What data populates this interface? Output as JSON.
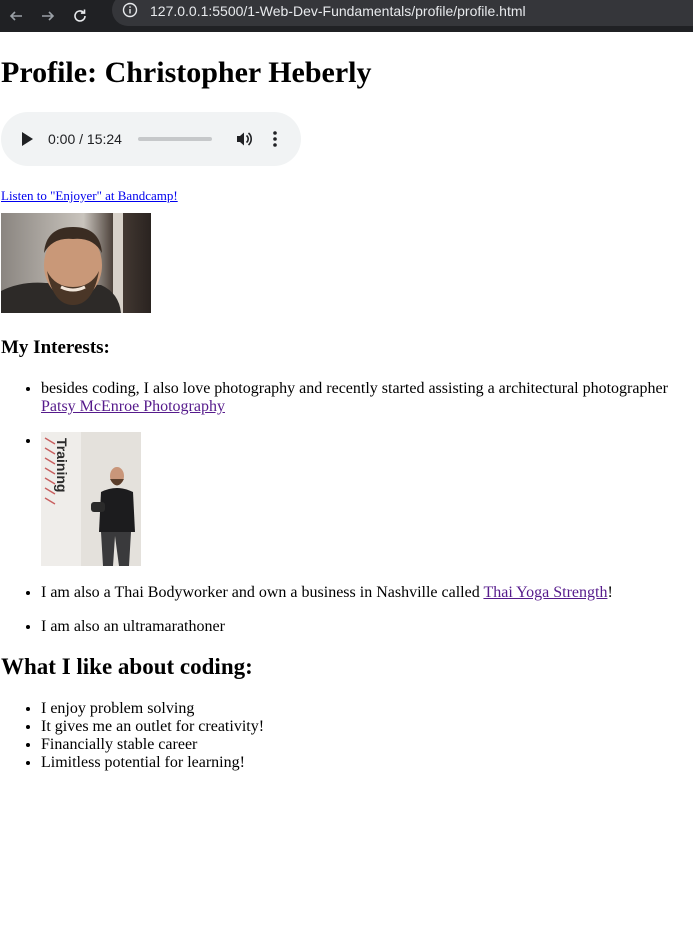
{
  "browser": {
    "url": "127.0.0.1:5500/1-Web-Dev-Fundamentals/profile/profile.html"
  },
  "page": {
    "title": "Profile: Christopher Heberly",
    "audio": {
      "time": "0:00 / 15:24"
    },
    "bandcamp_link": "Listen to \"Enjoyer\" at Bandcamp!",
    "interests_heading": "My Interests:",
    "interests": {
      "item1_text": "besides coding, I also love photography and recently started assisting a architectural photographer",
      "item1_link": "Patsy McEnroe Photography",
      "photo_sign_text": "Training",
      "item3_text": "I am also a Thai Bodyworker and own a business in Nashville called",
      "item3_link": "Thai Yoga Strength",
      "item3_suffix": "!",
      "item4_text": "I am also an ultramarathoner"
    },
    "coding_heading": "What I like about coding:",
    "coding_items": [
      "I enjoy problem solving",
      "It gives me an outlet for creativity!",
      "Financially stable career",
      "Limitless potential for learning!"
    ]
  },
  "colors": {
    "link": "#0000ee",
    "visited_link": "#551a8b",
    "chrome_bg": "#202124",
    "audio_bg": "#f1f3f4"
  },
  "icons": [
    "back-arrow-icon",
    "forward-arrow-icon",
    "reload-icon",
    "info-icon",
    "play-icon",
    "volume-icon",
    "more-vert-icon"
  ]
}
